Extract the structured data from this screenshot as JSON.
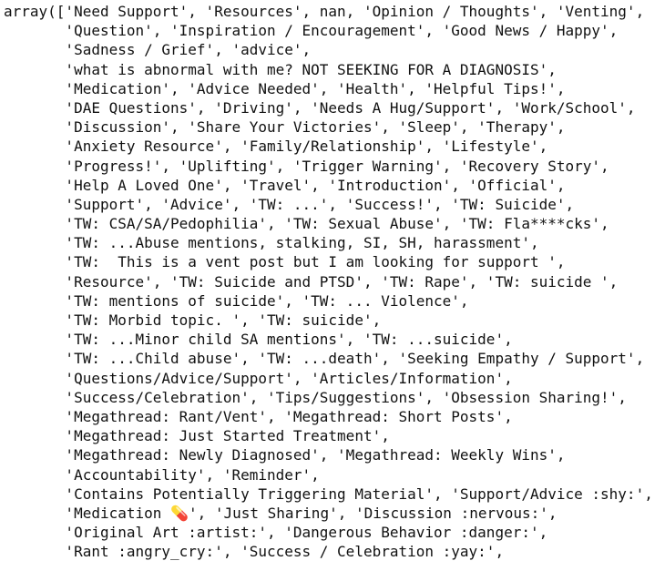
{
  "output": {
    "lines": [
      "array(['Need Support', 'Resources', nan, 'Opinion / Thoughts', 'Venting',",
      "       'Question', 'Inspiration / Encouragement', 'Good News / Happy',",
      "       'Sadness / Grief', 'advice',",
      "       'what is abnormal with me? NOT SEEKING FOR A DIAGNOSIS',",
      "       'Medication', 'Advice Needed', 'Health', 'Helpful Tips!',",
      "       'DAE Questions', 'Driving', 'Needs A Hug/Support', 'Work/School',",
      "       'Discussion', 'Share Your Victories', 'Sleep', 'Therapy',",
      "       'Anxiety Resource', 'Family/Relationship', 'Lifestyle',",
      "       'Progress!', 'Uplifting', 'Trigger Warning', 'Recovery Story',",
      "       'Help A Loved One', 'Travel', 'Introduction', 'Official',",
      "       'Support', 'Advice', 'TW: ...', 'Success!', 'TW: Suicide',",
      "       'TW: CSA/SA/Pedophilia', 'TW: Sexual Abuse', 'TW: Fla****cks',",
      "       'TW: ...Abuse mentions, stalking, SI, SH, harassment',",
      "       'TW:  This is a vent post but I am looking for support ',",
      "       'Resource', 'TW: Suicide and PTSD', 'TW: Rape', 'TW: suicide ',",
      "       'TW: mentions of suicide', 'TW: ... Violence',",
      "       'TW: Morbid topic. ', 'TW: suicide',",
      "       'TW: ...Minor child SA mentions', 'TW: ...suicide',",
      "       'TW: ...Child abuse', 'TW: ...death', 'Seeking Empathy / Support',",
      "       'Questions/Advice/Support', 'Articles/Information',",
      "       'Success/Celebration', 'Tips/Suggestions', 'Obsession Sharing!',",
      "       'Megathread: Rant/Vent', 'Megathread: Short Posts',",
      "       'Megathread: Just Started Treatment',",
      "       'Megathread: Newly Diagnosed', 'Megathread: Weekly Wins',",
      "       'Accountability', 'Reminder',",
      "       'Contains Potentially Triggering Material', 'Support/Advice :shy:',",
      "       'Medication 💊', 'Just Sharing', 'Discussion :nervous:',",
      "       'Original Art :artist:', 'Dangerous Behavior :danger:',",
      "       'Rant :angry_cry:', 'Success / Celebration :yay:',"
    ]
  }
}
